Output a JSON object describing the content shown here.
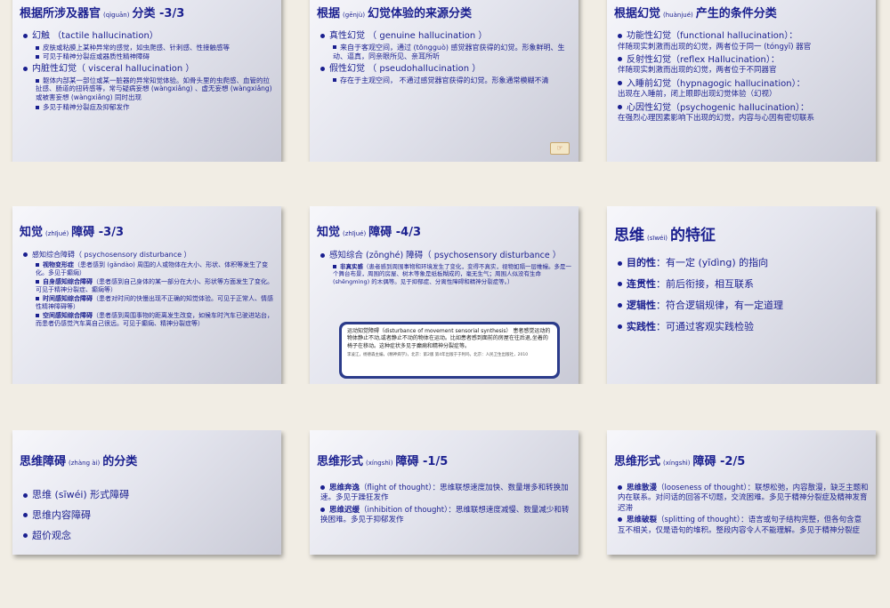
{
  "slides": [
    {
      "title": "根据所涉及器官",
      "title_py": "(qìguān)",
      "title_suffix": "分类 -3/3",
      "items": [
        {
          "level": 1,
          "text": "幻触 （tactile hallucination）"
        },
        {
          "level": 2,
          "text": "皮肤或粘膜上某种异常的感觉，如虫爬感、针刺感、性接触感等"
        },
        {
          "level": 2,
          "text": "可见于精神分裂症或器质性精神障碍"
        },
        {
          "level": 1,
          "text": "内脏性幻觉（ visceral hallucination ）"
        },
        {
          "level": 2,
          "text": "躯体内部某一部位或某一脏器的异常知觉体验。如骨头里的虫爬感、血管的拉扯感、肠道的扭转感等，常与疑病妄想 (wàngxiǎng) 、虚无妄想 (wàngxiǎng) 或被害妄想 (wàngxiǎng) 同时出现"
        },
        {
          "level": 2,
          "text": "多见于精神分裂症及抑郁发作"
        }
      ]
    },
    {
      "title": "根据",
      "title_py": "(gēnjù)",
      "title_suffix": "幻觉体验的来源分类",
      "items": [
        {
          "level": 1,
          "text": "真性幻觉 （ genuine hallucination ）"
        },
        {
          "level": 2,
          "text": "来自于客观空间，通过 (tōngguò) 感觉器官获得的幻觉。形象鲜明、生动、逼真，同亲眼所见、亲耳所听"
        },
        {
          "level": 1,
          "text": "假性幻觉 （ pseudohallucination ）"
        },
        {
          "level": 2,
          "text": "存在于主观空间， 不通过感觉器官获得的幻觉。形象通常模糊不清"
        }
      ]
    },
    {
      "title": "根据幻觉",
      "title_py": "(huànjué)",
      "title_suffix": "产生的条件分类",
      "items": [
        {
          "level": 1,
          "text": "功能性幻觉（functional hallucination）：",
          "sub": "伴随现实刺激而出现的幻觉，两者位于同一 (tóngyī) 器官"
        },
        {
          "level": 1,
          "text": "反射性幻觉（reflex Hallucination）：",
          "sub": "伴随现实刺激而出现的幻觉，两者位于不同器官"
        },
        {
          "level": 1,
          "text": "入睡前幻觉（hypnagogic hallucination）：",
          "sub": "出现在入睡前，闭上眼即出现幻觉体验（幻视）"
        },
        {
          "level": 1,
          "text": "心因性幻觉（psychogenic hallucination）：",
          "sub": "在强烈心理因素影响下出现的幻觉，内容与心因有密切联系"
        }
      ]
    },
    {
      "title": "知觉",
      "title_py": "(zhījué)",
      "title_suffix": "障碍 -3/3",
      "items": [
        {
          "level": 1,
          "text": "感知综合障碍（ psychosensory disturbance ）"
        },
        {
          "level": 2,
          "head": "视物变形症",
          "text": "（患者感到 (gǎndào) 周围的人或物体在大小、形状、体积等发生了变化。多见于癫痫）"
        },
        {
          "level": 2,
          "head": "自身感知综合障碍",
          "text": "（患者感到自己身体的某一部分在大小、形状等方面发生了变化。可见于精神分裂症、癫痫等）"
        },
        {
          "level": 2,
          "head": "时间感知综合障碍",
          "text": "（患者对时间的快慢出现不正确的知觉体验。可见于正常人、情感性精神障碍等）"
        },
        {
          "level": 2,
          "head": "空间感知综合障碍",
          "text": "（患者感到周围事物的距离发生改变，如候车时汽车已驶进站台，而患者仍感觉汽车离自己很远。可见于癫痫、精神分裂症等）"
        }
      ]
    },
    {
      "title": "知觉",
      "title_py": "(zhījué)",
      "title_suffix": "障碍 -4/3",
      "items": [
        {
          "level": 1,
          "text": "感知综合 (zōnghé) 障碍（ psychosensory disturbance ）"
        },
        {
          "level": 2,
          "head": "非真实感",
          "text": "（患者感到周围事物和环境发生了变化，变得不真实，视物如隔一层帷幔。多是一个舞台布景，周围的房屋、树木等象是纸板糊成的，毫无生气；周围人似没有生命 (shēngmìng) 的木偶等。见于抑郁症、分离性障碍和精神分裂症等。）"
        }
      ],
      "box": "运动知觉障碍（disturbance of movement sensorial synthesis） 患者感觉运动的物体静止不动,或者静止不动的物体在运动。比如患者感到面前的房屋在往后退,坐着的椅子在移动。这种症状多见于癫痫和精神分裂症等。",
      "box_ref": "李凌江，杨德森主编，《精神病学》，北京：第2版 第4年出版于于利吗，北京：人民卫生出版社，2010"
    },
    {
      "title": "思维",
      "title_py": "(sīwéi)",
      "title_suffix": "的特征",
      "items": [
        {
          "level": 1,
          "head": "目的性",
          "text": "：有一定 (yīdìng) 的指向"
        },
        {
          "level": 1,
          "head": "连贯性",
          "text": "：前后衔接，相互联系"
        },
        {
          "level": 1,
          "head": "逻辑性",
          "text": "：符合逻辑规律，有一定道理"
        },
        {
          "level": 1,
          "head": "实践性",
          "text": "：可通过客观实践检验"
        }
      ]
    },
    {
      "title": "思维障碍",
      "title_py": "(zhàng ài)",
      "title_suffix": "的分类",
      "items": [
        {
          "level": 1,
          "text": "思维 (sīwéi) 形式障碍"
        },
        {
          "level": 1,
          "text": "思维内容障碍"
        },
        {
          "level": 1,
          "text": "超价观念"
        }
      ]
    },
    {
      "title": "思维形式",
      "title_py": "(xíngshì)",
      "title_suffix": "障碍 -1/5",
      "items": [
        {
          "level": 1,
          "head": "思维奔逸",
          "text": "（flight of thought）：思维联想速度加快、数量增多和转换加速。多见于躁狂发作"
        },
        {
          "level": 1,
          "head": "思维迟缓",
          "text": "（inhibition of thought）：思维联想速度减慢、数量减少和转换困难。多见于抑郁发作"
        }
      ]
    },
    {
      "title": "思维形式",
      "title_py": "(xíngshì)",
      "title_suffix": "障碍 -2/5",
      "items": [
        {
          "level": 1,
          "head": "思维散漫",
          "text": "（looseness of thought）：联想松弛，内容散漫，缺乏主题和内在联系。对问话的回答不切题，交流困难。多见于精神分裂症及精神发育迟滞"
        },
        {
          "level": 1,
          "head": "思维破裂",
          "text": "（splitting of thought）：语言或句子结构完整，但各句含意互不相关，仅是语句的堆积。整段内容令人不能理解。多见于精神分裂症"
        }
      ]
    }
  ]
}
